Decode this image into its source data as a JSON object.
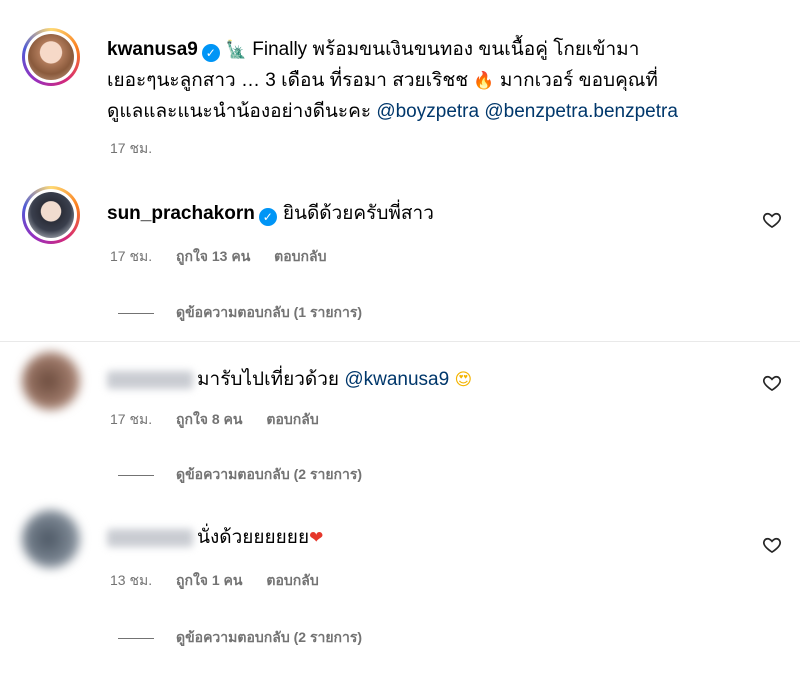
{
  "post": {
    "username": "kwanusa9",
    "verified": true,
    "caption_line1": "Finally พร้อมขนเงินขนทอง ขนเนื้อคู่ โกยเข้ามา",
    "caption_line2_a": "เยอะๆนะลูกสาว … 3 เดือน ที่รอมา สวยเริชช",
    "caption_line2_b": "มากเวอร์ ขอบคุณที่",
    "caption_line3": "ดูแลและแนะนำน้องอย่างดีนะคะ",
    "mention1": "@boyzpetra",
    "mention2": "@benzpetra.benzpetra",
    "time": "17 ชม.",
    "icons": [
      "statue-of-liberty-emoji",
      "fire-emoji"
    ]
  },
  "comments": [
    {
      "username": "sun_prachakorn",
      "verified": true,
      "text": "ยินดีด้วยครับพี่สาว",
      "time": "17 ชม.",
      "likes": "ถูกใจ 13 คน",
      "reply_label": "ตอบกลับ",
      "view_replies": "ดูข้อความตอบกลับ (1 รายการ)"
    },
    {
      "username_blurred": true,
      "text": "มารับไปเที่ยวด้วย",
      "mention": "@kwanusa9",
      "emoji": "heart-eyes-emoji",
      "time": "17 ชม.",
      "likes": "ถูกใจ 8 คน",
      "reply_label": "ตอบกลับ",
      "view_replies": "ดูข้อความตอบกลับ (2 รายการ)"
    },
    {
      "username_blurred": true,
      "text": "นั่งด้วยยยยยย",
      "emoji": "red-heart-emoji",
      "time": "13 ชม.",
      "likes": "ถูกใจ 1 คน",
      "reply_label": "ตอบกลับ",
      "view_replies": "ดูข้อความตอบกลับ (2 รายการ)"
    }
  ],
  "colors": {
    "link": "#00376b",
    "meta": "#737373",
    "verified": "#0095f6"
  }
}
